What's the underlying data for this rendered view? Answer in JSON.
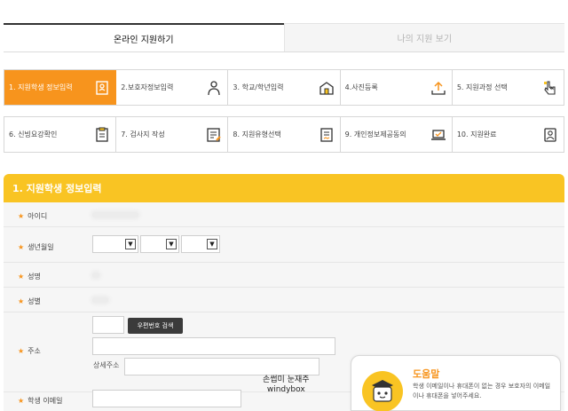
{
  "tabs": {
    "active": "온라인 지원하기",
    "inactive": "나의 지원 보기"
  },
  "steps": [
    {
      "label": "1. 지원학생 정보입력",
      "icon": "id-card-icon",
      "active": true
    },
    {
      "label": "2.보호자정보입력",
      "icon": "person-icon",
      "active": false
    },
    {
      "label": "3. 학교/학년입력",
      "icon": "school-icon",
      "active": false
    },
    {
      "label": "4.사진등록",
      "icon": "upload-icon",
      "active": false
    },
    {
      "label": "5. 지원과정 선택",
      "icon": "pointer-hand-icon",
      "active": false
    },
    {
      "label": "6. 신빙요강확인",
      "icon": "book-icon",
      "active": false
    },
    {
      "label": "7. 검사지 작성",
      "icon": "clipboard-icon",
      "active": false
    },
    {
      "label": "8. 지원유형선택",
      "icon": "document-icon",
      "active": false
    },
    {
      "label": "9. 개인정보제공동의",
      "icon": "laptop-icon",
      "active": false
    },
    {
      "label": "10. 지원완료",
      "icon": "portrait-icon",
      "active": false
    }
  ],
  "section": {
    "title": "1. 지원학생 정보입력"
  },
  "form": {
    "star": "★",
    "id_label": "아이디",
    "birth_label": "생년월일",
    "name_label": "성명",
    "gender_label": "성별",
    "address_label": "주소",
    "email_label": "학생 이메일",
    "zip_button": "우편번호 검색",
    "detail_label": "상세주소",
    "select_arrow": "▼"
  },
  "watermark": {
    "line1": "손썹미 눈재주",
    "line2": "windybox"
  },
  "help": {
    "title": "도움말",
    "text": "학생 이메일이나 휴대폰이 없는 경우 보호자의 이메일이나 휴대폰을 넣어주세요."
  },
  "colors": {
    "accent_orange": "#f7941d",
    "header_yellow": "#f9c423"
  }
}
